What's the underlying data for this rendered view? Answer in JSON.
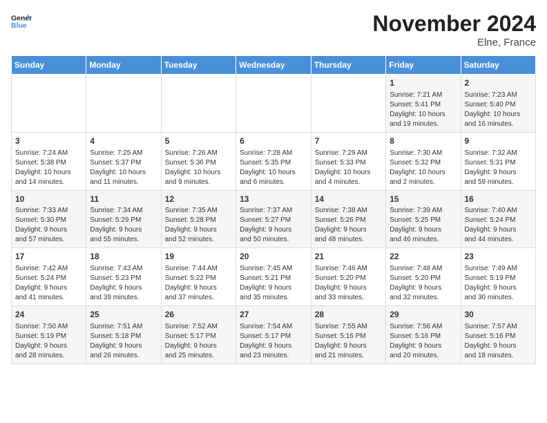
{
  "header": {
    "logo_line1": "General",
    "logo_line2": "Blue",
    "month": "November 2024",
    "location": "Elne, France"
  },
  "days_of_week": [
    "Sunday",
    "Monday",
    "Tuesday",
    "Wednesday",
    "Thursday",
    "Friday",
    "Saturday"
  ],
  "weeks": [
    [
      {
        "day": "",
        "info": ""
      },
      {
        "day": "",
        "info": ""
      },
      {
        "day": "",
        "info": ""
      },
      {
        "day": "",
        "info": ""
      },
      {
        "day": "",
        "info": ""
      },
      {
        "day": "1",
        "info": "Sunrise: 7:21 AM\nSunset: 5:41 PM\nDaylight: 10 hours\nand 19 minutes."
      },
      {
        "day": "2",
        "info": "Sunrise: 7:23 AM\nSunset: 5:40 PM\nDaylight: 10 hours\nand 16 minutes."
      }
    ],
    [
      {
        "day": "3",
        "info": "Sunrise: 7:24 AM\nSunset: 5:38 PM\nDaylight: 10 hours\nand 14 minutes."
      },
      {
        "day": "4",
        "info": "Sunrise: 7:25 AM\nSunset: 5:37 PM\nDaylight: 10 hours\nand 11 minutes."
      },
      {
        "day": "5",
        "info": "Sunrise: 7:26 AM\nSunset: 5:36 PM\nDaylight: 10 hours\nand 9 minutes."
      },
      {
        "day": "6",
        "info": "Sunrise: 7:28 AM\nSunset: 5:35 PM\nDaylight: 10 hours\nand 6 minutes."
      },
      {
        "day": "7",
        "info": "Sunrise: 7:29 AM\nSunset: 5:33 PM\nDaylight: 10 hours\nand 4 minutes."
      },
      {
        "day": "8",
        "info": "Sunrise: 7:30 AM\nSunset: 5:32 PM\nDaylight: 10 hours\nand 2 minutes."
      },
      {
        "day": "9",
        "info": "Sunrise: 7:32 AM\nSunset: 5:31 PM\nDaylight: 9 hours\nand 59 minutes."
      }
    ],
    [
      {
        "day": "10",
        "info": "Sunrise: 7:33 AM\nSunset: 5:30 PM\nDaylight: 9 hours\nand 57 minutes."
      },
      {
        "day": "11",
        "info": "Sunrise: 7:34 AM\nSunset: 5:29 PM\nDaylight: 9 hours\nand 55 minutes."
      },
      {
        "day": "12",
        "info": "Sunrise: 7:35 AM\nSunset: 5:28 PM\nDaylight: 9 hours\nand 52 minutes."
      },
      {
        "day": "13",
        "info": "Sunrise: 7:37 AM\nSunset: 5:27 PM\nDaylight: 9 hours\nand 50 minutes."
      },
      {
        "day": "14",
        "info": "Sunrise: 7:38 AM\nSunset: 5:26 PM\nDaylight: 9 hours\nand 48 minutes."
      },
      {
        "day": "15",
        "info": "Sunrise: 7:39 AM\nSunset: 5:25 PM\nDaylight: 9 hours\nand 46 minutes."
      },
      {
        "day": "16",
        "info": "Sunrise: 7:40 AM\nSunset: 5:24 PM\nDaylight: 9 hours\nand 44 minutes."
      }
    ],
    [
      {
        "day": "17",
        "info": "Sunrise: 7:42 AM\nSunset: 5:24 PM\nDaylight: 9 hours\nand 41 minutes."
      },
      {
        "day": "18",
        "info": "Sunrise: 7:43 AM\nSunset: 5:23 PM\nDaylight: 9 hours\nand 39 minutes."
      },
      {
        "day": "19",
        "info": "Sunrise: 7:44 AM\nSunset: 5:22 PM\nDaylight: 9 hours\nand 37 minutes."
      },
      {
        "day": "20",
        "info": "Sunrise: 7:45 AM\nSunset: 5:21 PM\nDaylight: 9 hours\nand 35 minutes."
      },
      {
        "day": "21",
        "info": "Sunrise: 7:46 AM\nSunset: 5:20 PM\nDaylight: 9 hours\nand 33 minutes."
      },
      {
        "day": "22",
        "info": "Sunrise: 7:48 AM\nSunset: 5:20 PM\nDaylight: 9 hours\nand 32 minutes."
      },
      {
        "day": "23",
        "info": "Sunrise: 7:49 AM\nSunset: 5:19 PM\nDaylight: 9 hours\nand 30 minutes."
      }
    ],
    [
      {
        "day": "24",
        "info": "Sunrise: 7:50 AM\nSunset: 5:19 PM\nDaylight: 9 hours\nand 28 minutes."
      },
      {
        "day": "25",
        "info": "Sunrise: 7:51 AM\nSunset: 5:18 PM\nDaylight: 9 hours\nand 26 minutes."
      },
      {
        "day": "26",
        "info": "Sunrise: 7:52 AM\nSunset: 5:17 PM\nDaylight: 9 hours\nand 25 minutes."
      },
      {
        "day": "27",
        "info": "Sunrise: 7:54 AM\nSunset: 5:17 PM\nDaylight: 9 hours\nand 23 minutes."
      },
      {
        "day": "28",
        "info": "Sunrise: 7:55 AM\nSunset: 5:16 PM\nDaylight: 9 hours\nand 21 minutes."
      },
      {
        "day": "29",
        "info": "Sunrise: 7:56 AM\nSunset: 5:16 PM\nDaylight: 9 hours\nand 20 minutes."
      },
      {
        "day": "30",
        "info": "Sunrise: 7:57 AM\nSunset: 5:16 PM\nDaylight: 9 hours\nand 18 minutes."
      }
    ]
  ]
}
